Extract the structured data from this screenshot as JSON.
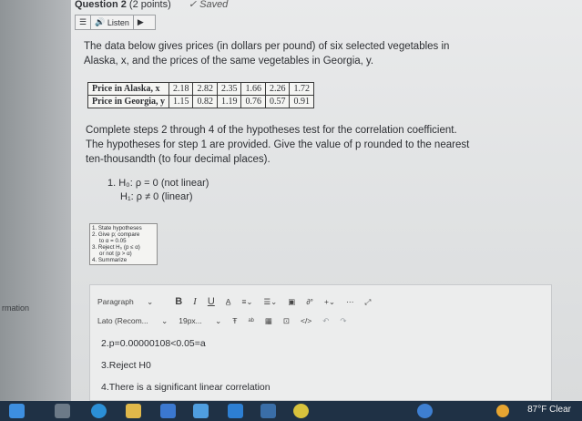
{
  "left_label": "rmation",
  "question": {
    "title": "Question 2",
    "points": "(2 points)",
    "saved": "Saved"
  },
  "listen": {
    "label": "Listen"
  },
  "problem": {
    "line1": "The data below gives prices (in dollars per pound) of six selected vegetables in",
    "line2": "Alaska, x, and the prices of the same vegetables in Georgia, y."
  },
  "table": {
    "rows": [
      {
        "label": "Price in Alaska, x",
        "values": [
          "2.18",
          "2.82",
          "2.35",
          "1.66",
          "2.26",
          "1.72"
        ]
      },
      {
        "label": "Price in Georgia, y",
        "values": [
          "1.15",
          "0.82",
          "1.19",
          "0.76",
          "0.57",
          "0.91"
        ]
      }
    ]
  },
  "instructions": {
    "line1": "Complete steps 2 through 4 of the hypotheses test for the correlation coefficient.",
    "line2": "The hypotheses for step 1 are provided. Give the value of p rounded to the nearest",
    "line3": "ten-thousandth (to four decimal places)."
  },
  "hypotheses": {
    "h0": "1. H₀: ρ = 0 (not linear)",
    "h1": "H₁: ρ ≠ 0 (linear)"
  },
  "steps_box": {
    "s1": "1. State hypotheses",
    "s2": "2. Give p; compare",
    "s2b": "to α = 0.05",
    "s3": "3. Reject H₀ (p ≤ α)",
    "s3b": "or not (p > α)",
    "s4": "4. Summarize"
  },
  "toolbar": {
    "paragraph": "Paragraph",
    "bold": "B",
    "italic": "I",
    "underline": "U",
    "font_family": "Lato (Recom...",
    "font_size": "19px..."
  },
  "answers": {
    "a2": "2.p=0.00000108<0.05=a",
    "a3": "3.Reject H0",
    "a4": "4.There is a significant linear correlation"
  },
  "taskbar": {
    "weather": "87°F  Clear"
  },
  "colors": {
    "taskbar": "#1f3145",
    "accent": "#2f6db5"
  }
}
